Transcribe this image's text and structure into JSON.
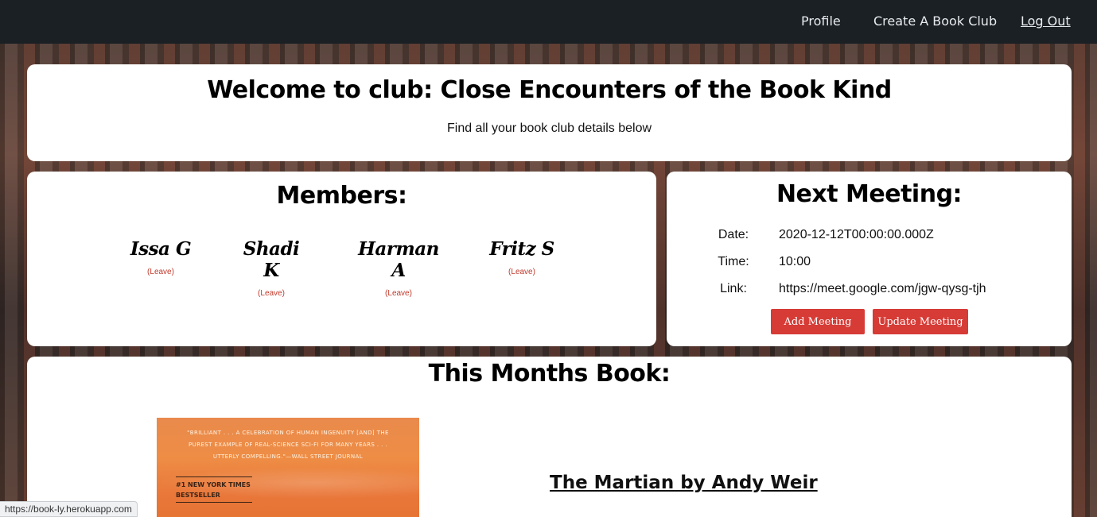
{
  "nav": {
    "profile": "Profile",
    "create_club": "Create A Book Club",
    "logout": "Log Out"
  },
  "welcome": {
    "title": "Welcome to club: Close Encounters of the Book Kind",
    "subtitle": "Find all your book club details below"
  },
  "members": {
    "title": "Members:",
    "leave_label": "(Leave)",
    "list": [
      {
        "name": "Issa G",
        "leave": "(Leave)"
      },
      {
        "name": "Shadi K",
        "leave": "(Leave)"
      },
      {
        "name": "Harman A",
        "leave": "(Leave)"
      },
      {
        "name": "Fritz S",
        "leave": "(Leave)"
      }
    ]
  },
  "meeting": {
    "title": "Next Meeting:",
    "date_label": "Date:",
    "date_value": "2020-12-12T00:00:00.000Z",
    "time_label": "Time:",
    "time_value": "10:00",
    "link_label": "Link:",
    "link_value": "https://meet.google.com/jgw-qysg-tjh",
    "add_button": "Add Meeting",
    "update_button": "Update Meeting"
  },
  "book": {
    "title": "This Months Book:",
    "link_text": "The Martian by Andy Weir",
    "cover_quote": "\"BRILLIANT . . . A CELEBRATION OF HUMAN INGENUITY [AND] THE PUREST EXAMPLE OF REAL-SCIENCE SCI-FI FOR MANY YEARS . . . UTTERLY COMPELLING.\"—WALL STREET JOURNAL",
    "cover_badge": "#1 NEW YORK TIMES BESTSELLER"
  },
  "status_bar": {
    "url": "https://book-ly.herokuapp.com"
  },
  "colors": {
    "navbar": "#1b2024",
    "button": "#d63b36",
    "leave": "#c0392b"
  }
}
